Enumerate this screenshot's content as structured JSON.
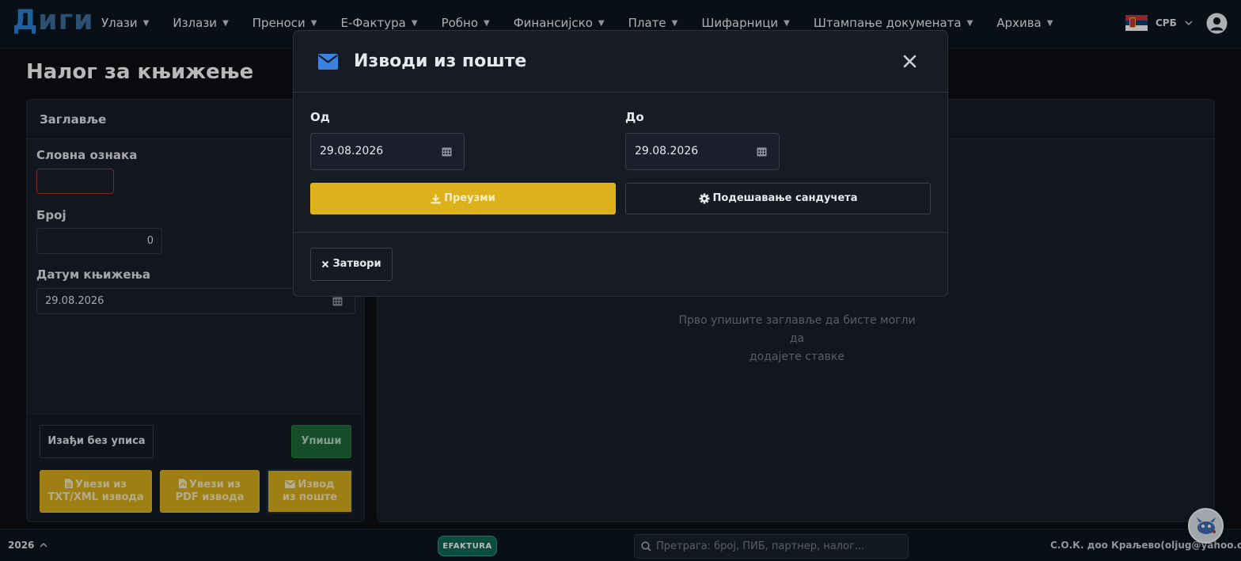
{
  "app": {
    "logo_part1": "Д",
    "logo_part2": "иги"
  },
  "nav": {
    "items": [
      {
        "label": "Улази"
      },
      {
        "label": "Излази"
      },
      {
        "label": "Преноси"
      },
      {
        "label": "Е-Фактура"
      },
      {
        "label": "Робно"
      },
      {
        "label": "Финансијско"
      },
      {
        "label": "Плате"
      },
      {
        "label": "Шифарници"
      },
      {
        "label": "Штампање докумената"
      },
      {
        "label": "Архива"
      }
    ],
    "caret": "▼",
    "language": "СРБ"
  },
  "page": {
    "title": "Налог за књижење"
  },
  "header_card": {
    "title": "Заглавље",
    "letter_label": "Словна ознака",
    "letter_value": "",
    "number_label": "Број",
    "number_value": "0",
    "date_label": "Датум књижења",
    "date_value": "29.08.2026",
    "exit_button": "Изађи без уписа",
    "save_button": "Упиши",
    "import_txt_line1": "Увези из",
    "import_txt_line2": "TXT/XML извода",
    "import_pdf_line1": "Увези из",
    "import_pdf_line2": "PDF извода",
    "mail_line1": "Извод",
    "mail_line2": "из поште"
  },
  "items_card": {
    "empty_line1": "Прво упишите заглавље да бисте могли да",
    "empty_line2": "додајете ставке"
  },
  "modal": {
    "title": "Изводи из поште",
    "from_label": "Од",
    "from_value": "29.08.2026",
    "to_label": "До",
    "to_value": "29.08.2026",
    "download_button": "Преузми",
    "settings_button": "Подешавање сандучета",
    "close_button": "Затвори"
  },
  "status": {
    "year": "2026",
    "efaktura": "EFAKTURA",
    "search_placeholder": "Претрага: број, ПИБ, партнер, налог...",
    "company": "С.О.К. доо Краљево(oljug@yahoo.com)"
  },
  "colors": {
    "accent_blue": "#2f86d6",
    "yellow": "#dcb11b",
    "green": "#1e6b3b",
    "efaktura_teal": "#0f6a58",
    "invalid_red": "#b0353a"
  },
  "icons": {
    "envelope": "envelope-icon",
    "close": "close-icon",
    "calendar": "calendar-icon",
    "download": "download-icon",
    "gear": "gear-icon",
    "file": "file-icon",
    "pdf": "file-pdf-icon",
    "user": "user-circle-icon",
    "search": "search-icon",
    "chevron": "chevron-down-icon"
  }
}
